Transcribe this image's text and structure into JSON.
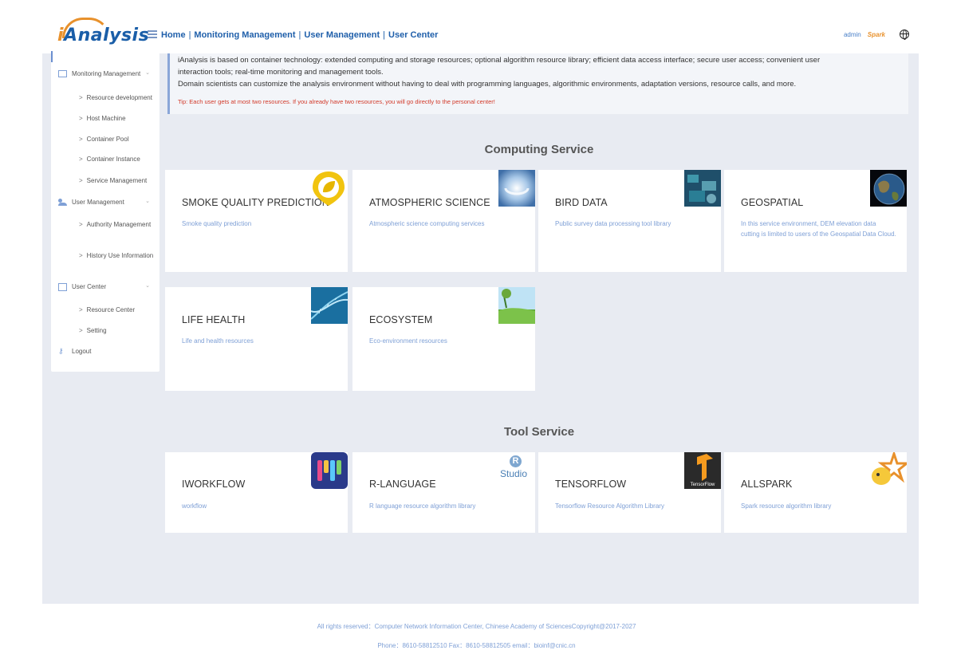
{
  "header": {
    "logo_text": "Analysis",
    "logo_i": "i",
    "nav": [
      "Home",
      "Monitoring Management",
      "User Management",
      "User Center"
    ],
    "nav_sep": "|",
    "user": "admin",
    "spark_text": "Spark",
    "language_icon": "globe-icon"
  },
  "sidebar": {
    "groups": [
      {
        "label": "Monitoring Management",
        "icon": "grid-icon",
        "items": [
          "Resource development",
          "Host Machine",
          "Container Pool",
          "Container Instance",
          "Service Management"
        ]
      },
      {
        "label": "User Management",
        "icon": "users-icon",
        "items": [
          "Authority Management",
          "History Use Information"
        ]
      },
      {
        "label": "User Center",
        "icon": "calendar-icon",
        "items": [
          "Resource Center",
          "Setting"
        ]
      }
    ],
    "logout": "Logout"
  },
  "intro": {
    "line1": "iAnalysis is based on container technology: extended computing and storage resources; optional algorithm resource library; efficient data access interface; secure user access; convenient user",
    "line2": "interaction tools; real-time monitoring and management tools.",
    "line3": "Domain scientists can customize the analysis environment without having to deal with programming languages, algorithmic environments, adaptation versions, resource calls, and more.",
    "tip": "Tip: Each user gets at most two resources. If you already have two resources, you will go directly to the personal center!"
  },
  "computing": {
    "title": "Computing Service",
    "cards": [
      {
        "title": "SMOKE QUALITY PREDICTION",
        "desc": "Smoke quality prediction"
      },
      {
        "title": "ATMOSPHERIC SCIENCE",
        "desc": "Atmospheric science computing services"
      },
      {
        "title": "BIRD DATA",
        "desc": "Public survey data processing tool library"
      },
      {
        "title": "GEOSPATIAL",
        "desc": "In this service environment, DEM elevation data cutting is limited to users of the Geospatial Data Cloud."
      },
      {
        "title": "LIFE HEALTH",
        "desc": "Life and health resources"
      },
      {
        "title": "ECOSYSTEM",
        "desc": "Eco-environment resources"
      }
    ]
  },
  "tools": {
    "title": "Tool Service",
    "cards": [
      {
        "title": "IWORKFLOW",
        "desc": "workflow"
      },
      {
        "title": "R-LANGUAGE",
        "desc": "R language resource algorithm library"
      },
      {
        "title": "TENSORFLOW",
        "desc": "Tensorflow Resource Algorithm Library"
      },
      {
        "title": "ALLSPARK",
        "desc": "Spark resource algorithm library"
      }
    ],
    "rstudio_r": "R",
    "rstudio_text": "Studio",
    "tensorflow_label": "TensorFlow"
  },
  "footer": {
    "line1": "All rights reserved：Computer Network Information Center, Chinese Academy of SciencesCopyright@2017-2027",
    "line2": "Phone：8610-58812510   Fax：8610-58812505    email：bioinf@cnic.cn"
  }
}
